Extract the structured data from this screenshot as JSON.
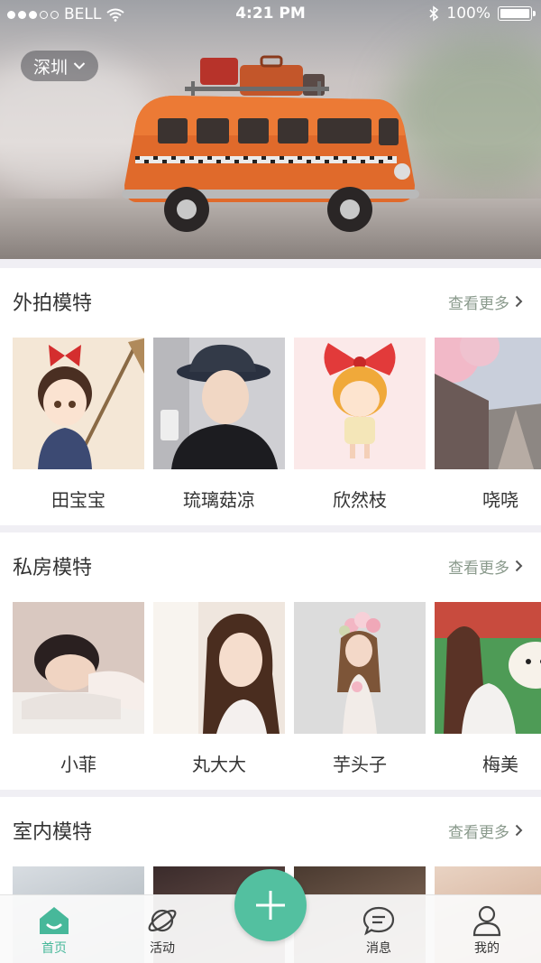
{
  "status": {
    "carrier": "BELL",
    "time": "4:21 PM",
    "battery": "100%",
    "signal_bars": 3,
    "signal_total": 5
  },
  "header": {
    "city": "深圳"
  },
  "sections": [
    {
      "title": "外拍模特",
      "more": "查看更多",
      "models": [
        "田宝宝",
        "琉璃菇凉",
        "欣然枝",
        "哓哓"
      ]
    },
    {
      "title": "私房模特",
      "more": "查看更多",
      "models": [
        "小菲",
        "丸大大",
        "芋头子",
        "梅美"
      ]
    },
    {
      "title": "室内模特",
      "more": "查看更多",
      "models": []
    }
  ],
  "tabbar": {
    "tabs": [
      {
        "label": "首页",
        "icon": "home-icon",
        "active": true
      },
      {
        "label": "活动",
        "icon": "planet-icon",
        "active": false
      },
      {
        "label": "消息",
        "icon": "chat-bubble-icon",
        "active": false
      },
      {
        "label": "我的",
        "icon": "user-icon",
        "active": false
      }
    ],
    "fab_icon": "plus-icon"
  },
  "colors": {
    "accent": "#53c0a0",
    "active_tab": "#47b89a",
    "more_link": "#8a9a8c",
    "background": "#f0eff4"
  }
}
